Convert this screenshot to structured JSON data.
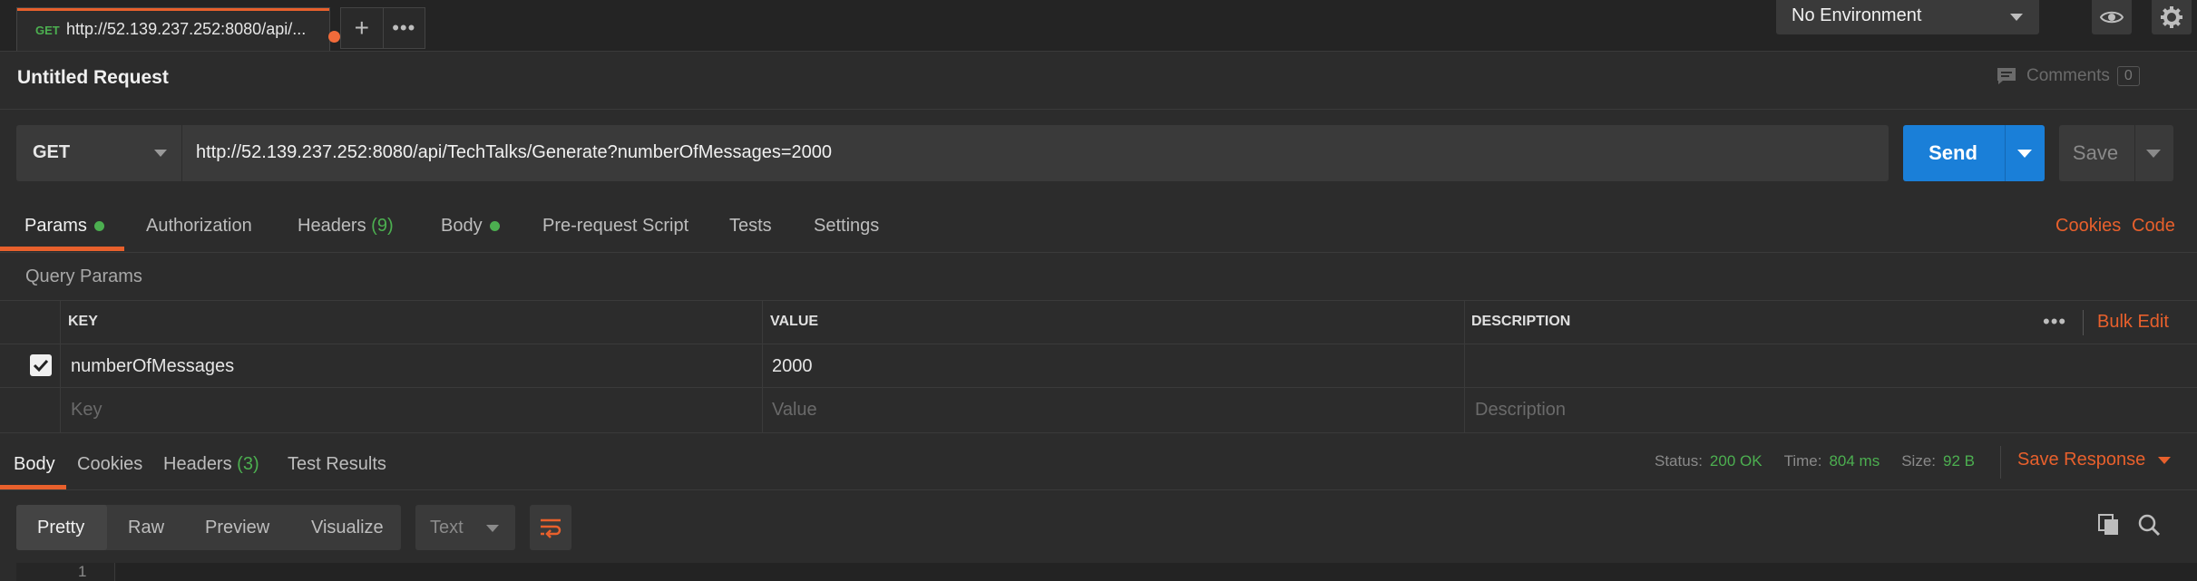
{
  "request_tab": {
    "method": "GET",
    "url": "http://52.139.237.252:8080/api/..."
  },
  "environment": {
    "selected": "No Environment"
  },
  "request": {
    "title": "Untitled Request",
    "comments_label": "Comments",
    "comments_count": "0",
    "method": "GET",
    "url": "http://52.139.237.252:8080/api/TechTalks/Generate?numberOfMessages=2000",
    "send_label": "Send",
    "save_label": "Save"
  },
  "request_tabs": {
    "params": "Params",
    "authorization": "Authorization",
    "headers": "Headers",
    "headers_count": "(9)",
    "body": "Body",
    "pre_request": "Pre-request Script",
    "tests": "Tests",
    "settings": "Settings",
    "cookies": "Cookies",
    "code": "Code"
  },
  "query_params": {
    "title": "Query Params",
    "columns": {
      "key": "KEY",
      "value": "VALUE",
      "description": "DESCRIPTION"
    },
    "bulk_edit": "Bulk Edit",
    "rows": [
      {
        "checked": true,
        "key": "numberOfMessages",
        "value": "2000",
        "description": ""
      }
    ],
    "placeholders": {
      "key": "Key",
      "value": "Value",
      "description": "Description"
    }
  },
  "response": {
    "tabs": {
      "body": "Body",
      "cookies": "Cookies",
      "headers": "Headers",
      "headers_count": "(3)",
      "test_results": "Test Results"
    },
    "status_label": "Status:",
    "status_value": "200 OK",
    "time_label": "Time:",
    "time_value": "804 ms",
    "size_label": "Size:",
    "size_value": "92 B",
    "save_response": "Save Response",
    "view_tabs": {
      "pretty": "Pretty",
      "raw": "Raw",
      "preview": "Preview",
      "visualize": "Visualize"
    },
    "format": "Text",
    "line_number": "1"
  },
  "colors": {
    "accent": "#e8602c",
    "send": "#1a7fd8",
    "success": "#4caf50",
    "background": "#2c2c2c"
  },
  "icons": [
    "plus-icon",
    "more-icon",
    "eye-icon",
    "gear-icon",
    "comment-icon",
    "check-icon",
    "wrap-icon",
    "copy-icon",
    "search-icon"
  ]
}
